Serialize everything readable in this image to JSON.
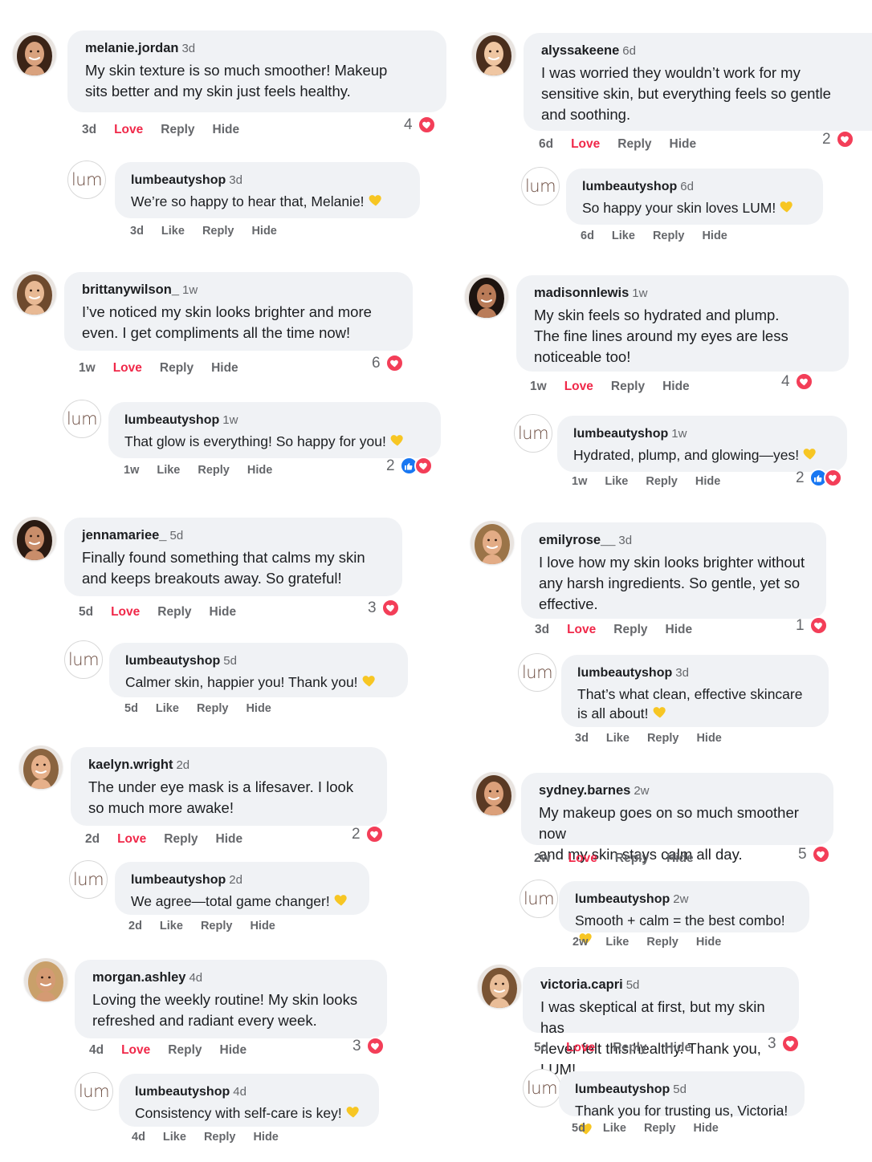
{
  "colors": {
    "love": "#f02849",
    "heart_reaction": "#f33e58",
    "like_reaction": "#1877f2",
    "bubble": "#f0f2f5",
    "meta": "#65676b"
  },
  "labels": {
    "love": "Love",
    "like": "Like",
    "reply": "Reply",
    "hide": "Hide",
    "brand_logo_text": "lum"
  },
  "reply_emoji": "yellow-heart-emoji",
  "left": [
    {
      "comment": {
        "username": "melanie.jordan",
        "time": "3d",
        "lines": [
          "My skin texture is so much smoother! Makeup",
          "sits better and my skin just feels healthy."
        ],
        "reaction_count": "4",
        "reactions": [
          "heart"
        ]
      },
      "reply": {
        "username": "lumbeautyshop",
        "time": "3d",
        "lines": [
          "We’re so happy to hear that, Melanie!"
        ],
        "reaction_count": "",
        "reactions": []
      }
    },
    {
      "comment": {
        "username": "brittanywilson_",
        "time": "1w",
        "lines": [
          "I’ve noticed my skin looks brighter and more",
          "even. I get compliments all the time now!"
        ],
        "reaction_count": "6",
        "reactions": [
          "heart"
        ]
      },
      "reply": {
        "username": "lumbeautyshop",
        "time": "1w",
        "lines": [
          "That glow is everything! So happy for you!"
        ],
        "reaction_count": "2",
        "reactions": [
          "like",
          "heart"
        ]
      }
    },
    {
      "comment": {
        "username": "jennamariee_",
        "time": "5d",
        "lines": [
          "Finally found something that calms my skin",
          "and keeps breakouts away. So grateful!"
        ],
        "reaction_count": "3",
        "reactions": [
          "heart"
        ]
      },
      "reply": {
        "username": "lumbeautyshop",
        "time": "5d",
        "lines": [
          "Calmer skin, happier you! Thank you!"
        ],
        "reaction_count": "",
        "reactions": []
      }
    },
    {
      "comment": {
        "username": "kaelyn.wright",
        "time": "2d",
        "lines": [
          "The under eye mask is a lifesaver. I look",
          "so much more awake!"
        ],
        "reaction_count": "2",
        "reactions": [
          "heart"
        ]
      },
      "reply": {
        "username": "lumbeautyshop",
        "time": "2d",
        "lines": [
          "We agree—total game changer!"
        ],
        "reaction_count": "",
        "reactions": []
      }
    },
    {
      "comment": {
        "username": "morgan.ashley",
        "time": "4d",
        "lines": [
          "Loving the weekly routine! My skin looks",
          "refreshed and radiant every week."
        ],
        "reaction_count": "3",
        "reactions": [
          "heart"
        ]
      },
      "reply": {
        "username": "lumbeautyshop",
        "time": "4d",
        "lines": [
          "Consistency with self-care is key!"
        ],
        "reaction_count": "",
        "reactions": []
      }
    }
  ],
  "right": [
    {
      "comment": {
        "username": "alyssakeene",
        "time": "6d",
        "lines": [
          "I was worried they wouldn’t work for my",
          "sensitive skin, but everything feels so gentle",
          "and soothing."
        ],
        "reaction_count": "2",
        "reactions": [
          "heart"
        ]
      },
      "reply": {
        "username": "lumbeautyshop",
        "time": "6d",
        "lines": [
          "So happy your skin loves LUM!"
        ],
        "reaction_count": "",
        "reactions": []
      }
    },
    {
      "comment": {
        "username": "madisonnlewis",
        "time": "1w",
        "lines": [
          "My skin feels so hydrated and plump.",
          "The fine lines around my eyes are less",
          "noticeable too!"
        ],
        "reaction_count": "4",
        "reactions": [
          "heart"
        ]
      },
      "reply": {
        "username": "lumbeautyshop",
        "time": "1w",
        "lines": [
          "Hydrated, plump, and glowing—yes!"
        ],
        "reaction_count": "2",
        "reactions": [
          "like",
          "heart"
        ]
      }
    },
    {
      "comment": {
        "username": "emilyrose__",
        "time": "3d",
        "lines": [
          "I love how my skin looks brighter without",
          "any harsh ingredients. So gentle, yet so",
          "effective."
        ],
        "reaction_count": "1",
        "reactions": [
          "heart"
        ]
      },
      "reply": {
        "username": "lumbeautyshop",
        "time": "3d",
        "lines": [
          "That’s what clean, effective skincare",
          "is all about!"
        ],
        "reaction_count": "",
        "reactions": []
      }
    },
    {
      "comment": {
        "username": "sydney.barnes",
        "time": "2w",
        "lines": [
          "My makeup goes on so much smoother now",
          "and my skin stays calm all day."
        ],
        "reaction_count": "5",
        "reactions": [
          "heart"
        ]
      },
      "reply": {
        "username": "lumbeautyshop",
        "time": "2w",
        "lines": [
          "Smooth + calm = the best combo!"
        ],
        "reaction_count": "",
        "reactions": []
      }
    },
    {
      "comment": {
        "username": "victoria.capri",
        "time": "5d",
        "lines": [
          "I was skeptical at first, but my skin has",
          "never felt this healthy. Thank you, LUM!"
        ],
        "reaction_count": "3",
        "reactions": [
          "heart"
        ]
      },
      "reply": {
        "username": "lumbeautyshop",
        "time": "5d",
        "lines": [
          "Thank you for trusting us, Victoria!"
        ],
        "reaction_count": "",
        "reactions": []
      }
    }
  ]
}
